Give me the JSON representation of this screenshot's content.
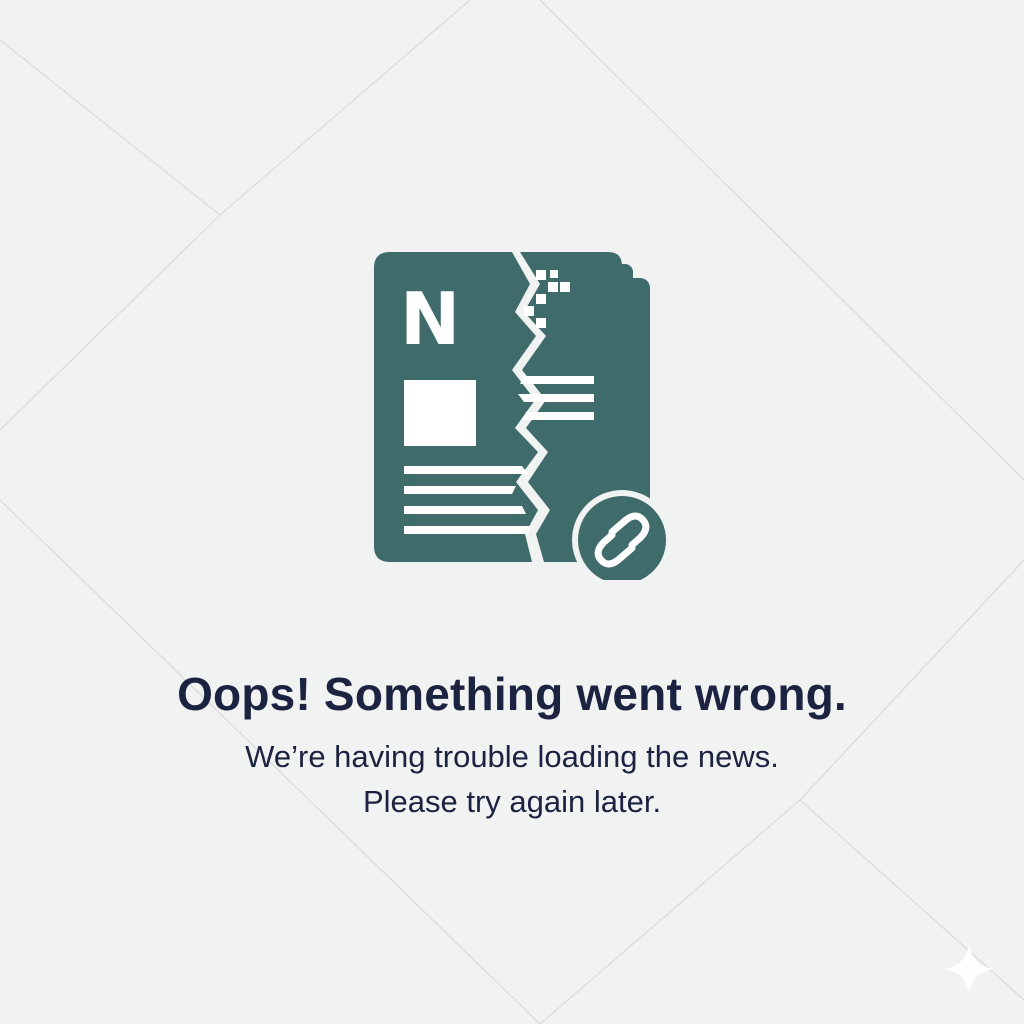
{
  "error": {
    "title": "Oops! Something went wrong.",
    "message_line1": "We’re having trouble loading the news.",
    "message_line2": "Please try again later."
  },
  "illustration": {
    "masthead_letter": "N",
    "icon": "broken-newspaper-icon",
    "badge_icon": "broken-link-icon"
  },
  "colors": {
    "accent": "#3f6b6b",
    "text": "#1c2341",
    "background": "#f1f2f2"
  }
}
